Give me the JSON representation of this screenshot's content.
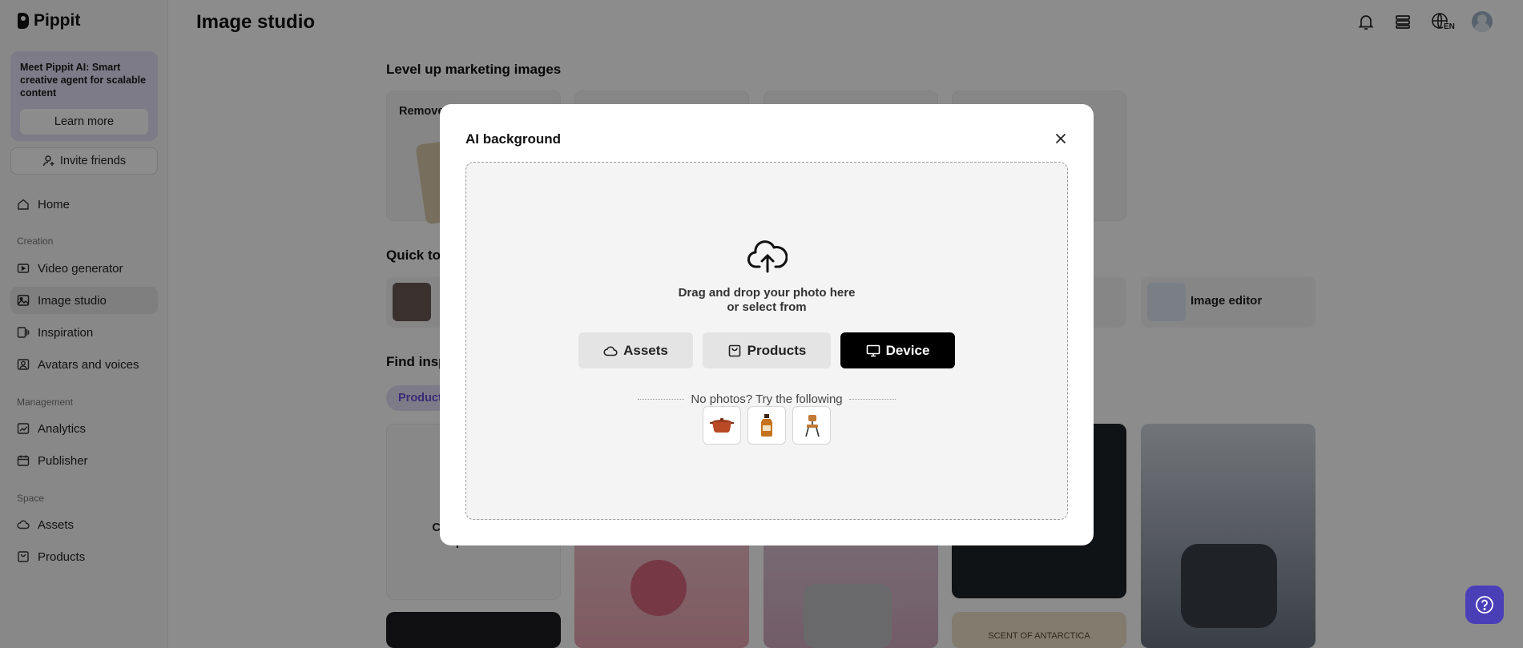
{
  "app": {
    "name": "Pippit",
    "page_title": "Image studio"
  },
  "sidebar": {
    "promo_text": "Meet Pippit AI: Smart creative agent for scalable content",
    "promo_button": "Learn more",
    "invite_label": "Invite friends",
    "home": "Home",
    "section_creation": "Creation",
    "creation_items": [
      "Video generator",
      "Image studio",
      "Inspiration",
      "Avatars and voices"
    ],
    "section_management": "Management",
    "management_items": [
      "Analytics",
      "Publisher"
    ],
    "section_space": "Space",
    "space_items": [
      "Assets",
      "Products"
    ]
  },
  "header": {
    "language": "EN"
  },
  "main": {
    "section1_title": "Level up marketing images",
    "card1_label": "Remove",
    "section2_title": "Quick too",
    "tool_image_editor": "Image editor",
    "section3_title": "Find insp",
    "chip_label": "Product",
    "poster_text": "Create product poster",
    "gallery_caption": "SCENT OF ANTARCTICA"
  },
  "modal": {
    "title": "AI background",
    "drop_line1": "Drag and drop your photo here",
    "drop_line2": "or select from",
    "btn_assets": "Assets",
    "btn_products": "Products",
    "btn_device": "Device",
    "no_photos": "No photos? Try the following",
    "samples": [
      "pot-sample",
      "bottle-sample",
      "chair-sample"
    ]
  },
  "colors": {
    "accent": "#6a4fd6",
    "help_button": "#4b3fb8",
    "primary_button": "#000000"
  }
}
